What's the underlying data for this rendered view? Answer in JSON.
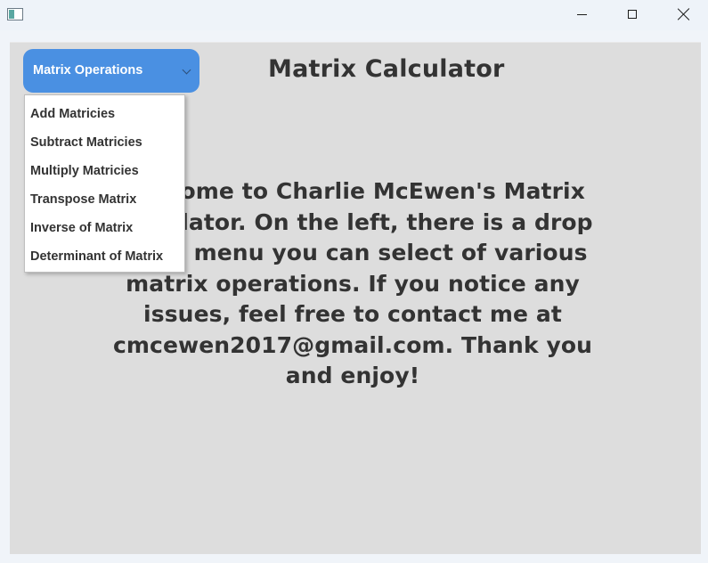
{
  "window": {
    "icon": "app-icon",
    "buttons": [
      "minimize-icon",
      "maximize-icon",
      "close-icon"
    ]
  },
  "header": {
    "title": "Matrix Calculator"
  },
  "dropdown": {
    "label": "Matrix Operations",
    "icon": "chevron-down-icon",
    "accent_color": "#4a90e2",
    "items": [
      {
        "label": "Add Matricies"
      },
      {
        "label": "Subtract Matricies"
      },
      {
        "label": "Multiply Matricies"
      },
      {
        "label": "Transpose Matrix"
      },
      {
        "label": "Inverse of Matrix"
      },
      {
        "label": "Determinant of Matrix"
      }
    ]
  },
  "main": {
    "welcome_text": "Welcome to Charlie McEwen's Matrix Calculator. On the left, there is a drop down menu you can select of various matrix operations. If you notice any issues, feel free to contact me at cmcewen2017@gmail.com. Thank you and enjoy!"
  }
}
